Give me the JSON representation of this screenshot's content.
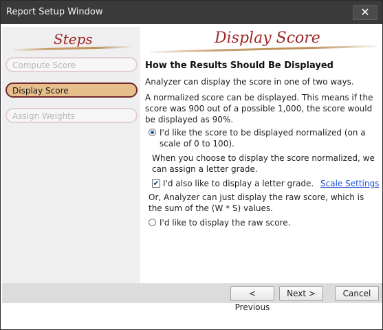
{
  "window": {
    "title": "Report Setup Window",
    "close_glyph": "✕"
  },
  "sidebar": {
    "heading": "Steps",
    "items": [
      {
        "label": "Compute Score",
        "state": "inactive"
      },
      {
        "label": "Display Score",
        "state": "active"
      },
      {
        "label": "Assign Weights",
        "state": "inactive"
      }
    ]
  },
  "main": {
    "heading": "Display Score",
    "section_title": "How the Results Should Be Displayed",
    "intro": "Analyzer can display the score in one of two ways.",
    "normalized_desc": "A normalized score can be displayed. This means if the score was 900 out of a possible 1,000, the score would be displayed as 90%.",
    "radio_normalized": {
      "label": "I'd like the score to be displayed normalized (on a scale of 0 to 100).",
      "checked": true
    },
    "letter_grade_desc": "When you choose to display the score normalized, we can assign a letter grade.",
    "checkbox_letter": {
      "label": "I'd also like to display a letter grade.",
      "checked": true,
      "check_glyph": "✔"
    },
    "scale_link": "Scale Settings",
    "raw_desc": "Or, Analyzer can just display the raw score, which is the sum of the (W * S) values.",
    "radio_raw": {
      "label": "I'd like to display the raw score.",
      "checked": false
    }
  },
  "footer": {
    "previous": "< Previous",
    "next": "Next >",
    "cancel": "Cancel"
  }
}
